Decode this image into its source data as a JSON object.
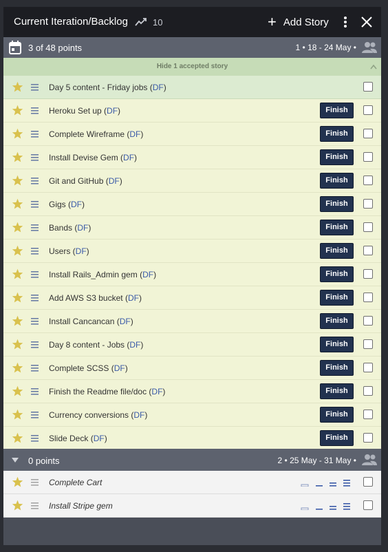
{
  "header": {
    "title": "Current Iteration/Backlog",
    "velocity": "10",
    "add_story_label": "Add Story"
  },
  "iteration": {
    "points_label": "3 of 48 points",
    "range_label": "1 • 18 - 24 May •"
  },
  "accepted_toggle": {
    "label": "Hide 1 accepted story"
  },
  "stories": [
    {
      "title": "Day 5 content - Friday jobs",
      "owner": "DF",
      "state": "accepted",
      "action": ""
    },
    {
      "title": "Heroku Set up",
      "owner": "DF",
      "state": "started",
      "action": "Finish"
    },
    {
      "title": "Complete Wireframe",
      "owner": "DF",
      "state": "started",
      "action": "Finish"
    },
    {
      "title": "Install Devise Gem",
      "owner": "DF",
      "state": "started",
      "action": "Finish"
    },
    {
      "title": "Git and GitHub",
      "owner": "DF",
      "state": "started",
      "action": "Finish"
    },
    {
      "title": "Gigs",
      "owner": "DF",
      "state": "started",
      "action": "Finish"
    },
    {
      "title": "Bands",
      "owner": "DF",
      "state": "started",
      "action": "Finish"
    },
    {
      "title": "Users",
      "owner": "DF",
      "state": "started",
      "action": "Finish"
    },
    {
      "title": "Install Rails_Admin gem",
      "owner": "DF",
      "state": "started",
      "action": "Finish"
    },
    {
      "title": "Add AWS S3 bucket ",
      "owner": "DF",
      "state": "started",
      "action": "Finish"
    },
    {
      "title": "Install Cancancan",
      "owner": "DF",
      "state": "started",
      "action": "Finish"
    },
    {
      "title": "Day 8 content - Jobs",
      "owner": "DF",
      "state": "started",
      "action": "Finish"
    },
    {
      "title": "Complete SCSS",
      "owner": "DF",
      "state": "started",
      "action": "Finish"
    },
    {
      "title": "Finish the Readme file/doc",
      "owner": "DF",
      "state": "started",
      "action": "Finish"
    },
    {
      "title": "Currency conversions",
      "owner": "DF",
      "state": "started",
      "action": "Finish"
    },
    {
      "title": "Slide Deck",
      "owner": "DF",
      "state": "started",
      "action": "Finish"
    }
  ],
  "backlog": {
    "points_label": "0 points",
    "range_label": "2 • 25 May - 31 May •",
    "stories": [
      {
        "title": "Complete Cart"
      },
      {
        "title": "Install Stripe gem"
      }
    ]
  },
  "colors": {
    "star": "#d9c14d",
    "finish_button": "#22324f",
    "accepted_row": "#dcebd1",
    "started_row": "#f1f4d6",
    "owner_link": "#3a5aa8"
  },
  "icons": {
    "velocity": "trend-icon",
    "add": "plus-icon",
    "menu": "more-vertical-icon",
    "close": "close-icon",
    "iteration": "calendar-icon",
    "members": "people-icon",
    "story_type": "star-icon",
    "drag": "drag-handle-icon",
    "estimate": "estimate-bars-icon"
  }
}
